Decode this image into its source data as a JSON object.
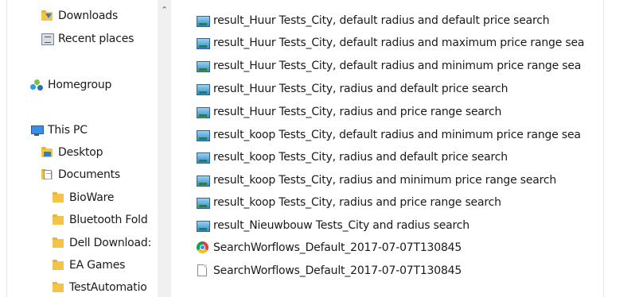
{
  "nav": {
    "items": [
      {
        "label": "Downloads",
        "icon": "downloads-folder-icon"
      },
      {
        "label": "Recent places",
        "icon": "recent-places-icon"
      },
      {
        "label": "Homegroup",
        "icon": "homegroup-icon"
      },
      {
        "label": "This PC",
        "icon": "this-pc-icon"
      },
      {
        "label": "Desktop",
        "icon": "desktop-folder-icon"
      },
      {
        "label": "Documents",
        "icon": "documents-icon"
      },
      {
        "label": "BioWare",
        "icon": "folder-icon"
      },
      {
        "label": "Bluetooth Fold",
        "icon": "folder-icon"
      },
      {
        "label": "Dell Download:",
        "icon": "folder-icon"
      },
      {
        "label": "EA Games",
        "icon": "folder-icon"
      },
      {
        "label": "TestAutomatio",
        "icon": "folder-icon"
      }
    ]
  },
  "files": [
    {
      "name": "result_Huur Tests_City, default radius and default price search",
      "icon": "image-file-icon"
    },
    {
      "name": "result_Huur Tests_City, default radius and maximum price range sea",
      "icon": "image-file-icon"
    },
    {
      "name": "result_Huur Tests_City, default radius and minimum price range sea",
      "icon": "image-file-icon"
    },
    {
      "name": "result_Huur Tests_City, radius and default price search",
      "icon": "image-file-icon"
    },
    {
      "name": "result_Huur Tests_City, radius and price range search",
      "icon": "image-file-icon"
    },
    {
      "name": "result_koop Tests_City, default radius and minimum price range sea",
      "icon": "image-file-icon"
    },
    {
      "name": "result_koop Tests_City, radius and default price search",
      "icon": "image-file-icon"
    },
    {
      "name": "result_koop Tests_City, radius and minimum price range search",
      "icon": "image-file-icon"
    },
    {
      "name": "result_koop Tests_City, radius and price range search",
      "icon": "image-file-icon"
    },
    {
      "name": "result_Nieuwbouw Tests_City and radius search",
      "icon": "image-file-icon"
    },
    {
      "name": "SearchWorflows_Default_2017-07-07T130845",
      "icon": "chrome-html-icon"
    },
    {
      "name": "SearchWorflows_Default_2017-07-07T130845",
      "icon": "text-file-icon"
    }
  ]
}
